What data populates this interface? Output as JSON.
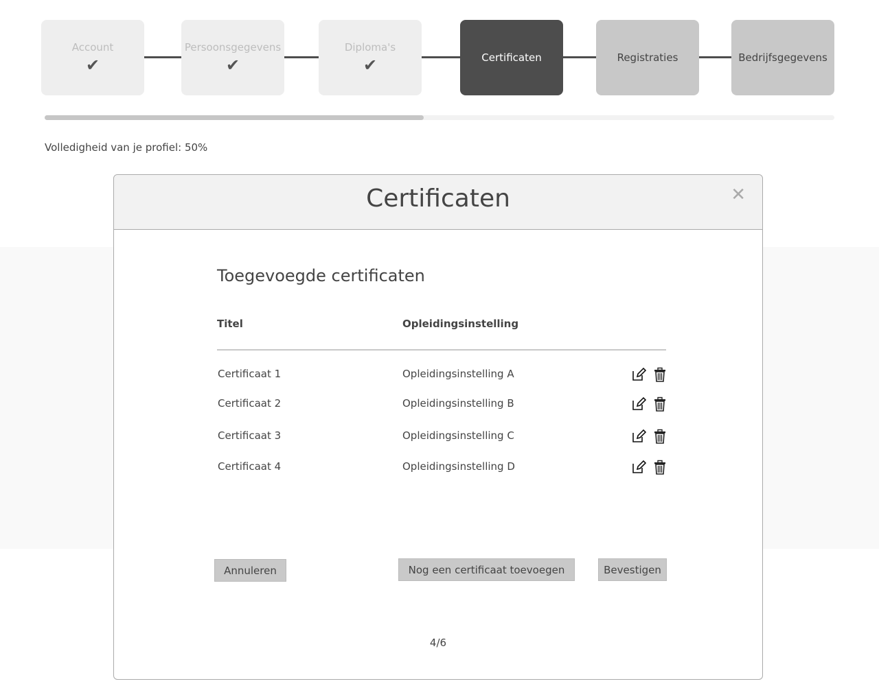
{
  "steps": [
    {
      "label": "Account",
      "state": "done"
    },
    {
      "label": "Persoonsgegevens",
      "state": "done"
    },
    {
      "label": "Diploma's",
      "state": "done"
    },
    {
      "label": "Certificaten",
      "state": "current"
    },
    {
      "label": "Registraties",
      "state": "todo"
    },
    {
      "label": "Bedrijfsgegevens",
      "state": "todo"
    }
  ],
  "progress": {
    "fill_fraction": 0.48,
    "label": "Volledigheid van je profiel: 50%"
  },
  "modal": {
    "title": "Certificaten",
    "close_icon": "close-icon",
    "section_title": "Toegevoegde certificaten",
    "columns": [
      "Titel",
      "Opleidingsinstelling"
    ],
    "rows": [
      {
        "title": "Certificaat 1",
        "institution": "Opleidingsinstelling A"
      },
      {
        "title": "Certificaat 2",
        "institution": "Opleidingsinstelling B"
      },
      {
        "title": "Certificaat 3",
        "institution": "Opleidingsinstelling C"
      },
      {
        "title": "Certificaat 4",
        "institution": "Opleidingsinstelling D"
      }
    ],
    "buttons": {
      "cancel": "Annuleren",
      "add_another": "Nog een certificaat toevoegen",
      "confirm": "Bevestigen"
    },
    "page": "4/6"
  }
}
